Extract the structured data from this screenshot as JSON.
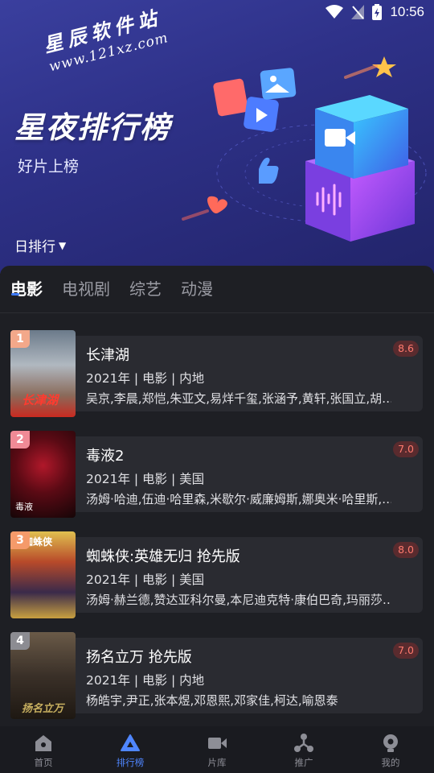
{
  "status_bar": {
    "time": "10:56"
  },
  "hero": {
    "watermark_cn": "星辰软件站",
    "watermark_url": "www.121xz.com",
    "title": "星夜排行榜",
    "subtitle": "好片上榜",
    "rank_selector": "日排行"
  },
  "tabs": [
    {
      "label": "电影",
      "active": true
    },
    {
      "label": "电视剧",
      "active": false
    },
    {
      "label": "综艺",
      "active": false
    },
    {
      "label": "动漫",
      "active": false
    }
  ],
  "items": [
    {
      "rank": "1",
      "title": "长津湖",
      "meta": "2021年 | 电影 | 内地",
      "cast": "吴京,李晨,郑恺,朱亚文,易烊千玺,张涵予,黄轩,张国立,胡…",
      "score": "8.6",
      "badge_color": "#f3a88a",
      "poster_text": "长津湖"
    },
    {
      "rank": "2",
      "title": "毒液2",
      "meta": "2021年 | 电影 | 美国",
      "cast": "汤姆·哈迪,伍迪·哈里森,米歇尔·威廉姆斯,娜奥米·哈里斯,…",
      "score": "7.0",
      "badge_color": "#f08a96",
      "poster_text": "毒液"
    },
    {
      "rank": "3",
      "title": "蜘蛛侠:英雄无归 抢先版",
      "meta": "2021年 | 电影 | 美国",
      "cast": "汤姆·赫兰德,赞达亚科尔曼,本尼迪克特·康伯巴奇,玛丽莎…",
      "score": "8.0",
      "badge_color": "#f59a6a",
      "poster_text": "蜘蛛侠"
    },
    {
      "rank": "4",
      "title": "扬名立万 抢先版",
      "meta": "2021年 | 电影 | 内地",
      "cast": "杨皓宇,尹正,张本煜,邓恩熙,邓家佳,柯达,喻恩泰",
      "score": "7.0",
      "badge_color": "#8c8c92",
      "poster_text": "扬名立万"
    }
  ],
  "bottom_nav": [
    {
      "label": "首页",
      "icon": "home-icon",
      "active": false
    },
    {
      "label": "排行榜",
      "icon": "ranking-icon",
      "active": true
    },
    {
      "label": "片库",
      "icon": "video-library-icon",
      "active": false
    },
    {
      "label": "推广",
      "icon": "share-icon",
      "active": false
    },
    {
      "label": "我的",
      "icon": "profile-icon",
      "active": false
    }
  ],
  "colors": {
    "accent": "#4f86ff",
    "score_text": "#ff7a6e",
    "hero_bg": "#2e3188",
    "card_bg": "#2a2b31"
  }
}
